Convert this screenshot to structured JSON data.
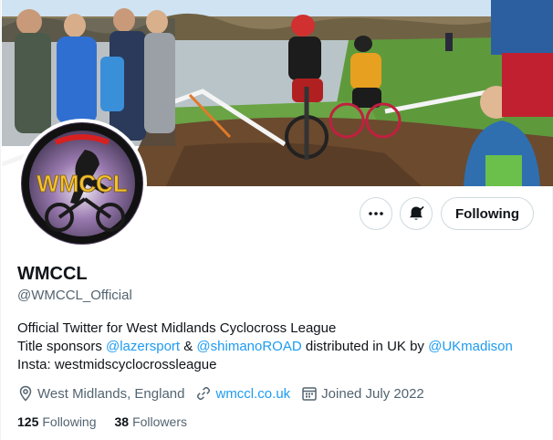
{
  "profile": {
    "display_name": "WMCCL",
    "handle": "@WMCCL_Official",
    "bio": {
      "line1": "Official Twitter for West Midlands Cyclocross League",
      "line2_prefix": "Title sponsors ",
      "mention1": "@lazersport",
      "line2_amp": " & ",
      "mention2": "@shimanoROAD",
      "line2_mid": " distributed in UK by ",
      "mention3": "@UKmadison",
      "line3": "Insta: westmidscyclocrossleague"
    },
    "location": "West Midlands, England",
    "website": "wmccl.co.uk",
    "joined": "Joined July 2022",
    "avatar_text": "WMCCL"
  },
  "stats": {
    "following_count": "125",
    "following_label": "Following",
    "followers_count": "38",
    "followers_label": "Followers"
  },
  "actions": {
    "more_icon": "more-icon",
    "notifications_icon": "bell-icon",
    "follow_button_label": "Following"
  },
  "colors": {
    "accent": "#1d9bf0",
    "text_primary": "#0f1419",
    "text_secondary": "#536471",
    "border": "#cfd9de"
  }
}
